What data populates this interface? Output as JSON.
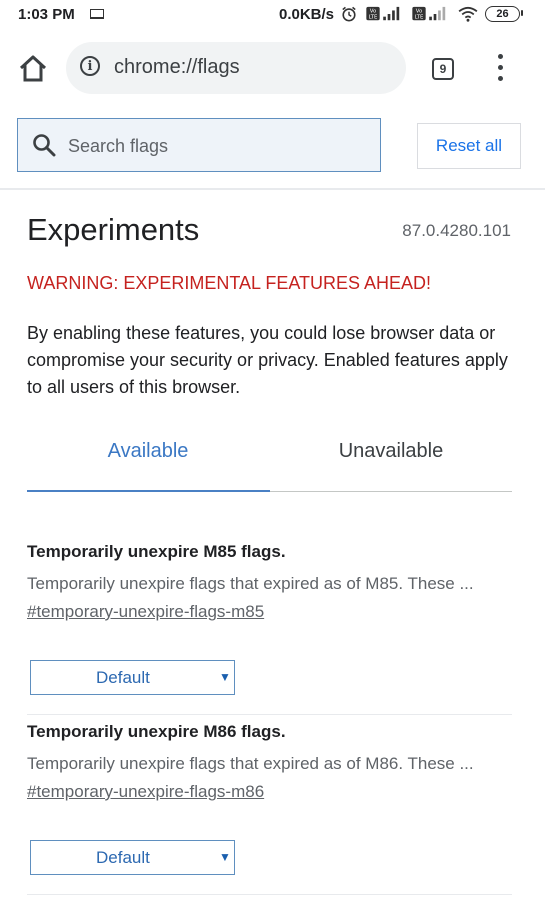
{
  "status_bar": {
    "time": "1:03 PM",
    "speed": "0.0KB/s",
    "battery": "26",
    "icons": [
      "screen-cast-icon",
      "alarm-icon",
      "volte-icon",
      "signal-icon",
      "wifi-icon",
      "battery-icon"
    ]
  },
  "toolbar": {
    "url": "chrome://flags",
    "tab_count": "9",
    "icons": [
      "home-icon",
      "info-icon",
      "tab-switcher-icon",
      "more-vert-icon"
    ]
  },
  "search": {
    "placeholder": "Search flags",
    "reset_label": "Reset all"
  },
  "page": {
    "title": "Experiments",
    "version": "87.0.4280.101",
    "warning": "WARNING: EXPERIMENTAL FEATURES AHEAD!",
    "description": "By enabling these features, you could lose browser data or compromise your security or privacy. Enabled features apply to all users of this browser."
  },
  "tabs": [
    {
      "label": "Available",
      "selected": true
    },
    {
      "label": "Unavailable",
      "selected": false
    }
  ],
  "flags": [
    {
      "title": "Temporarily unexpire M85 flags.",
      "description": "Temporarily unexpire flags that expired as of M85. These ...",
      "link": "#temporary-unexpire-flags-m85",
      "value": "Default"
    },
    {
      "title": "Temporarily unexpire M86 flags.",
      "description": "Temporarily unexpire flags that expired as of M86. These ...",
      "link": "#temporary-unexpire-flags-m86",
      "value": "Default"
    }
  ],
  "colors": {
    "accent": "#1a73e8",
    "warning": "#c5221f",
    "tab_indicator": "#4a80c4"
  }
}
